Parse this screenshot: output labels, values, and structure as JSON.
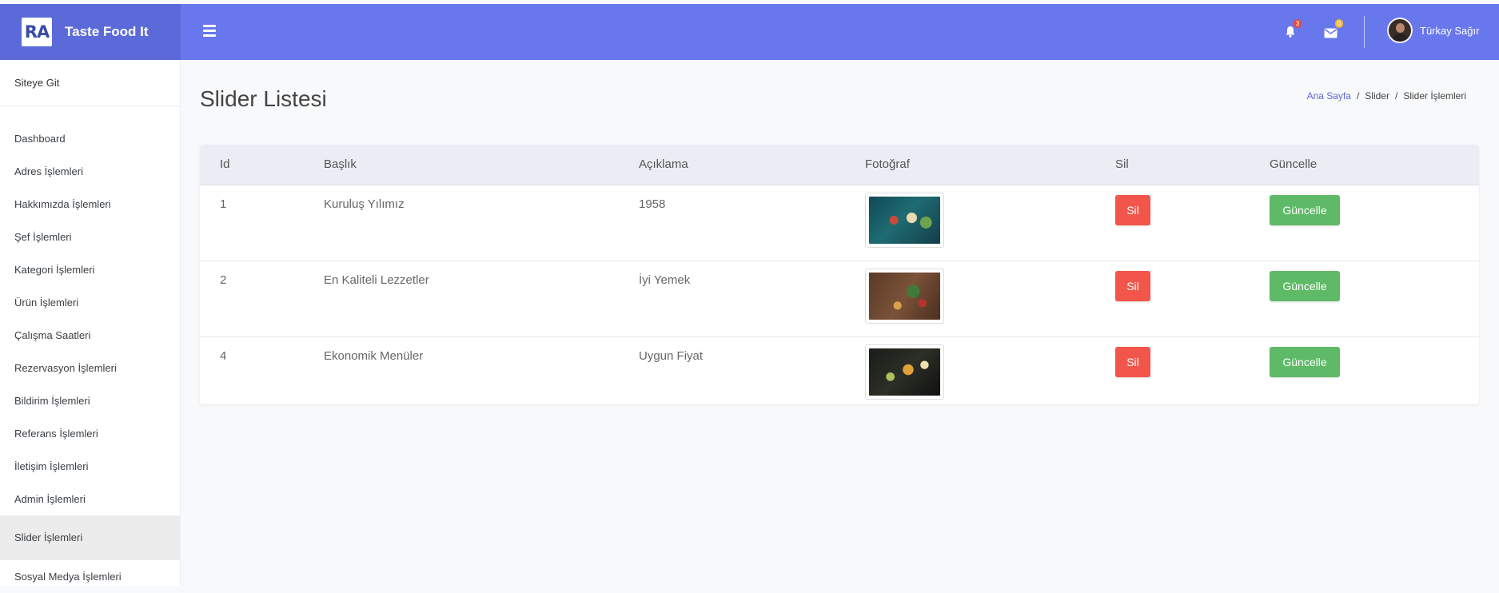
{
  "brand": {
    "logo_text": "RA",
    "name": "Taste Food It"
  },
  "navbar": {
    "notifications_count": "3",
    "messages_count": "0",
    "user_name": "Türkay Sağır"
  },
  "sidebar": {
    "top_link": "Siteye Git",
    "items": [
      {
        "label": "Dashboard"
      },
      {
        "label": "Adres İşlemleri"
      },
      {
        "label": "Hakkımızda İşlemleri"
      },
      {
        "label": "Şef İşlemleri"
      },
      {
        "label": "Kategori İşlemleri"
      },
      {
        "label": "Ürün İşlemleri"
      },
      {
        "label": "Çalışma Saatleri"
      },
      {
        "label": "Rezervasyon İşlemleri"
      },
      {
        "label": "Bildirim İşlemleri"
      },
      {
        "label": "Referans İşlemleri"
      },
      {
        "label": "İletişim İşlemleri"
      },
      {
        "label": "Admin İşlemleri"
      },
      {
        "label": "Slider İşlemleri",
        "active": true
      },
      {
        "label": "Sosyal Medya İşlemleri"
      }
    ]
  },
  "page": {
    "title": "Slider Listesi",
    "breadcrumb": [
      "Ana Sayfa",
      "Slider",
      "Slider İşlemleri"
    ]
  },
  "table": {
    "headers": [
      "Id",
      "Başlık",
      "Açıklama",
      "Fotoğraf",
      "Sil",
      "Güncelle"
    ],
    "rows": [
      {
        "id": "1",
        "title": "Kuruluş Yılımız",
        "description": "1958",
        "delete_label": "Sil",
        "update_label": "Güncelle"
      },
      {
        "id": "2",
        "title": "En Kaliteli Lezzetler",
        "description": "İyi Yemek",
        "delete_label": "Sil",
        "update_label": "Güncelle"
      },
      {
        "id": "4",
        "title": "Ekonomik Menüler",
        "description": "Uygun Fiyat",
        "delete_label": "Sil",
        "update_label": "Güncelle"
      }
    ]
  },
  "colors": {
    "brand_bg": "#5b6ad8",
    "navbar_bg": "#6877ec",
    "delete_button": "#f2564a",
    "update_button": "#5fba67",
    "breadcrumb_link": "#5b6ad8"
  },
  "icons": {
    "menu": "hamburger-icon",
    "notifications": "bell-icon",
    "messages": "envelope-icon"
  }
}
